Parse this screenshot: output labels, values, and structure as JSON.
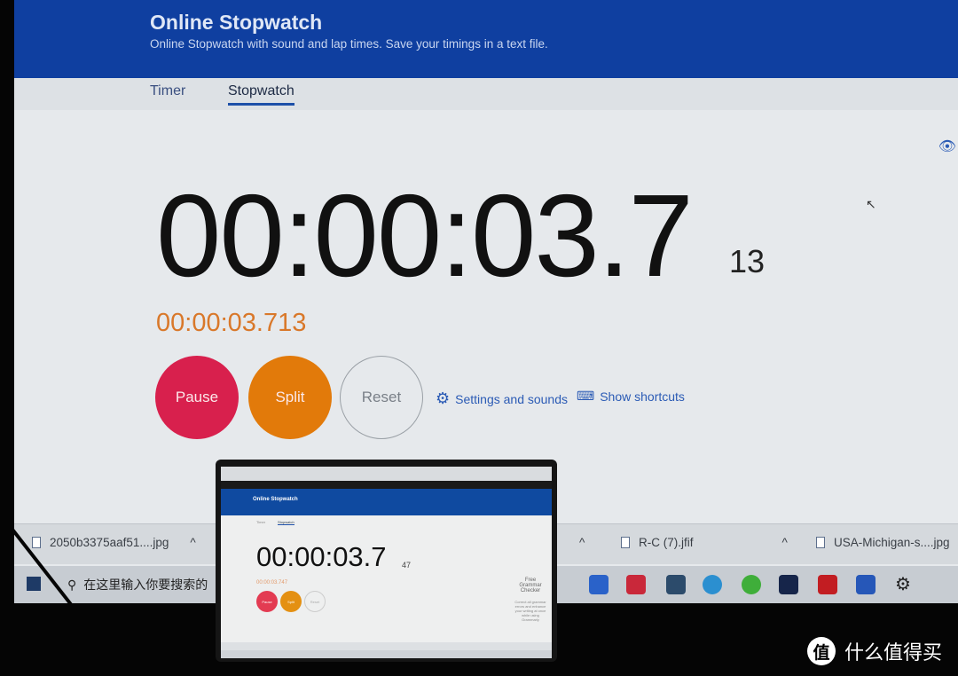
{
  "header": {
    "title": "Online Stopwatch",
    "subtitle": "Online Stopwatch with sound and lap times. Save your timings in a text file."
  },
  "tabs": [
    {
      "label": "Timer",
      "active": false
    },
    {
      "label": "Stopwatch",
      "active": true
    }
  ],
  "stopwatch": {
    "main": "00:00:03.7",
    "milliseconds": "13",
    "split_time": "00:00:03.713"
  },
  "buttons": {
    "pause": "Pause",
    "split": "Split",
    "reset": "Reset"
  },
  "links": {
    "settings": "Settings and sounds",
    "shortcuts": "Show shortcuts"
  },
  "colors": {
    "header": "#0f3fa0",
    "pause": "#d8204d",
    "split": "#e27a0a",
    "link": "#2b5bb5",
    "split_text": "#d9782a"
  },
  "downloads": [
    {
      "name": "2050b3375aaf51....jpg"
    },
    {
      "name": "R-C (7).jfif"
    },
    {
      "name": "USA-Michigan-s....jpg"
    }
  ],
  "taskbar": {
    "search_placeholder": "在这里输入你要搜索的"
  },
  "laptop": {
    "header_title": "Online Stopwatch",
    "tabs": [
      "Timer",
      "Stopwatch"
    ],
    "main": "00:00:03.7",
    "milliseconds": "47",
    "split_time": "00:00:03.747",
    "buttons": [
      "Pause",
      "Split",
      "Reset"
    ],
    "ad": {
      "title": "Free Grammar Checker",
      "text": "Correct all grammar errors and enhance your writing at once while using Grammarly"
    }
  },
  "watermark": {
    "logo_char": "值",
    "text": "什么值得买"
  }
}
